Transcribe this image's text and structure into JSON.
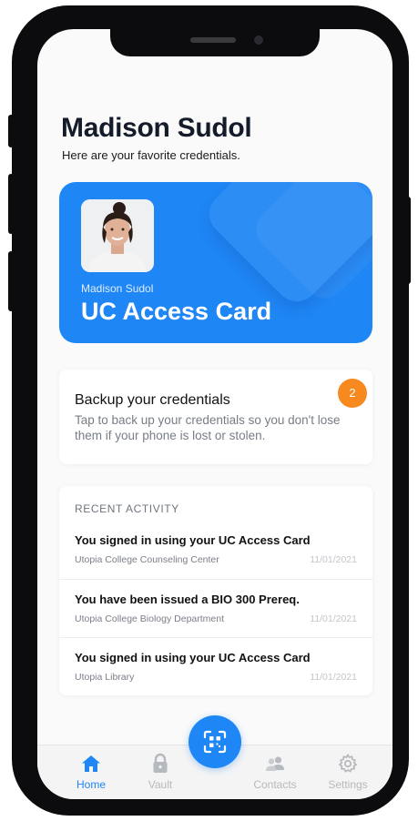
{
  "profile": {
    "name": "Madison Sudol",
    "subtitle": "Here are your favorite credentials."
  },
  "credential_card": {
    "holder_name": "Madison Sudol",
    "title": "UC Access Card",
    "color": "#1f86f5"
  },
  "backup": {
    "title": "Backup your credentials",
    "description": "Tap to back up your credentials so you don't lose them if your phone is lost or stolen.",
    "badge_count": "2",
    "badge_color": "#f7891e"
  },
  "recent_activity": {
    "header": "RECENT ACTIVITY",
    "items": [
      {
        "title": "You signed in using your UC Access Card",
        "source": "Utopia College Counseling Center",
        "date": "11/01/2021"
      },
      {
        "title": "You have been issued a BIO 300 Prereq.",
        "source": "Utopia College Biology Department",
        "date": "11/01/2021"
      },
      {
        "title": "You signed in using your UC Access Card",
        "source": "Utopia Library",
        "date": "11/01/2021"
      }
    ]
  },
  "tabbar": {
    "home": {
      "label": "Home",
      "icon": "home-icon"
    },
    "vault": {
      "label": "Vault",
      "icon": "lock-icon"
    },
    "scan": {
      "icon": "qr-scan-icon"
    },
    "contacts": {
      "label": "Contacts",
      "icon": "contacts-icon"
    },
    "settings": {
      "label": "Settings",
      "icon": "gear-icon"
    }
  },
  "colors": {
    "accent": "#1f86f5",
    "inactive": "#b6b9bd"
  }
}
